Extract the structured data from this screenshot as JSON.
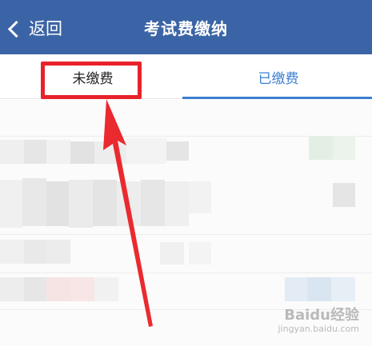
{
  "header": {
    "back_label": "返回",
    "title": "考试费缴纳",
    "background_color": "#3b64a6"
  },
  "tabs": [
    {
      "label": "未缴费",
      "active": false
    },
    {
      "label": "已缴费",
      "active": true
    }
  ],
  "annotation": {
    "highlight_color": "#e8222a"
  },
  "icons": {
    "back": "chevron-left-icon",
    "pointer": "red-arrow"
  },
  "watermark": {
    "logo": "Baidu经验",
    "site": "jingyan.baidu.com"
  }
}
